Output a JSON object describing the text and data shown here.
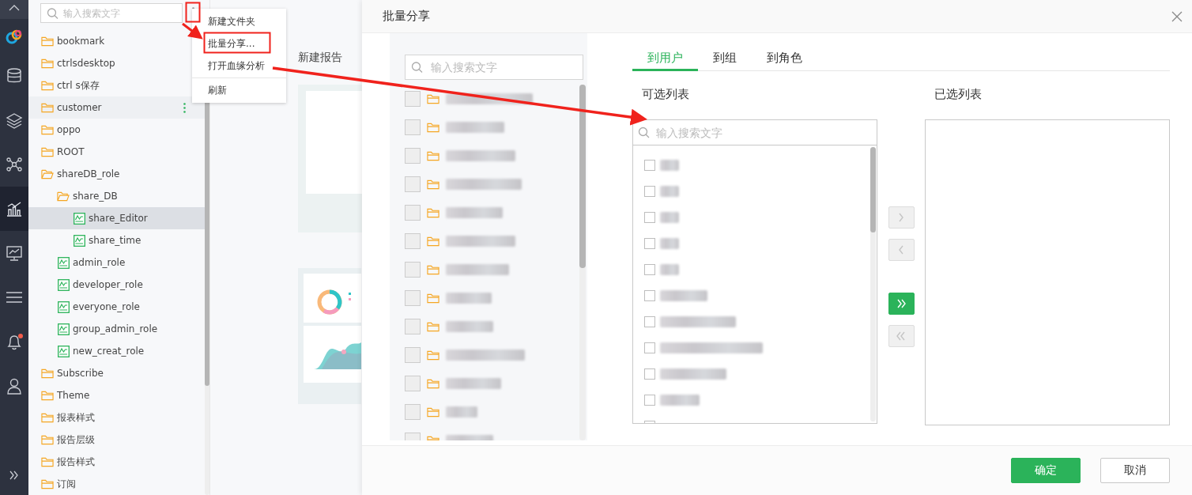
{
  "nav": [
    {
      "kind": "collapse-up",
      "selected": false,
      "alert": false
    },
    {
      "kind": "logo",
      "selected": false,
      "alert": false
    },
    {
      "kind": "database",
      "selected": false,
      "alert": false
    },
    {
      "kind": "layers",
      "selected": false,
      "alert": false
    },
    {
      "kind": "network",
      "selected": false,
      "alert": false
    },
    {
      "kind": "chart",
      "selected": true,
      "alert": false
    },
    {
      "kind": "monitor",
      "selected": false,
      "alert": false
    },
    {
      "kind": "menu",
      "selected": false,
      "alert": false
    },
    {
      "kind": "bell",
      "selected": false,
      "alert": true
    },
    {
      "kind": "user",
      "selected": false,
      "alert": false
    },
    {
      "kind": "expand",
      "selected": false,
      "alert": false
    }
  ],
  "tree": {
    "search": {
      "placeholder": "输入搜索文字"
    },
    "items": [
      {
        "label": "bookmark",
        "kind": "folder",
        "expanded": false,
        "selected": false,
        "hovered": false
      },
      {
        "label": "ctrlsdesktop",
        "kind": "folder",
        "expanded": false,
        "selected": false,
        "hovered": false
      },
      {
        "label": "ctrl s保存",
        "kind": "folder",
        "expanded": false,
        "selected": false,
        "hovered": false
      },
      {
        "label": "customer",
        "kind": "folder",
        "expanded": false,
        "selected": false,
        "hovered": true
      },
      {
        "label": "oppo",
        "kind": "folder",
        "expanded": false,
        "selected": false,
        "hovered": false
      },
      {
        "label": "ROOT",
        "kind": "folder",
        "expanded": false,
        "selected": false,
        "hovered": false
      },
      {
        "label": "shareDB_role",
        "kind": "folder",
        "expanded": true,
        "selected": false,
        "hovered": false,
        "children": [
          {
            "label": "share_DB",
            "kind": "folder",
            "expanded": true,
            "selected": false,
            "hovered": false,
            "children": [
              {
                "label": "share_Editor",
                "kind": "report",
                "selected": true,
                "hovered": false
              },
              {
                "label": "share_time",
                "kind": "report",
                "selected": false,
                "hovered": false
              }
            ]
          },
          {
            "label": "admin_role",
            "kind": "report",
            "selected": false,
            "hovered": false
          },
          {
            "label": "developer_role",
            "kind": "report",
            "selected": false,
            "hovered": false
          },
          {
            "label": "everyone_role",
            "kind": "report",
            "selected": false,
            "hovered": false
          },
          {
            "label": "group_admin_role",
            "kind": "report",
            "selected": false,
            "hovered": false
          },
          {
            "label": "new_creat_role",
            "kind": "report",
            "selected": false,
            "hovered": false
          }
        ]
      },
      {
        "label": "Subscribe",
        "kind": "folder",
        "expanded": false,
        "selected": false,
        "hovered": false
      },
      {
        "label": "Theme",
        "kind": "folder",
        "expanded": false,
        "selected": false,
        "hovered": false
      },
      {
        "label": "报表样式",
        "kind": "folder",
        "expanded": false,
        "selected": false,
        "hovered": false
      },
      {
        "label": "报告层级",
        "kind": "folder",
        "expanded": false,
        "selected": false,
        "hovered": false
      },
      {
        "label": "报告样式",
        "kind": "folder",
        "expanded": false,
        "selected": false,
        "hovered": false
      },
      {
        "label": "订阅",
        "kind": "folder",
        "expanded": false,
        "selected": false,
        "hovered": false
      }
    ]
  },
  "context_menu": {
    "items": [
      {
        "kind": "item",
        "label": "新建文件夹"
      },
      {
        "kind": "item",
        "label": "批量分享..."
      },
      {
        "kind": "item",
        "label": "打开血缘分析"
      },
      {
        "kind": "divider"
      },
      {
        "kind": "item",
        "label": "刷新"
      }
    ]
  },
  "main": {
    "heading": "新建报告"
  },
  "dialog": {
    "title": "批量分享",
    "source": {
      "search": {
        "placeholder": "输入搜索文字"
      },
      "rows": [
        {
          "checked": false
        },
        {
          "checked": false
        },
        {
          "checked": false
        },
        {
          "checked": false
        },
        {
          "checked": false
        },
        {
          "checked": false
        },
        {
          "checked": false
        },
        {
          "checked": false
        },
        {
          "checked": false
        },
        {
          "checked": false
        },
        {
          "checked": false
        },
        {
          "checked": false
        },
        {
          "checked": false
        }
      ]
    },
    "tabs": [
      {
        "label": "到用户",
        "selected": true
      },
      {
        "label": "到组",
        "selected": false
      },
      {
        "label": "到角色",
        "selected": false
      }
    ],
    "available": {
      "title": "可选列表",
      "search": {
        "placeholder": "输入搜索文字"
      },
      "rows": [
        {
          "checked": false
        },
        {
          "checked": false
        },
        {
          "checked": false
        },
        {
          "checked": false
        },
        {
          "checked": false
        },
        {
          "checked": false
        },
        {
          "checked": false
        },
        {
          "checked": false
        },
        {
          "checked": false
        },
        {
          "checked": false
        },
        {
          "checked": false
        }
      ]
    },
    "transfer_buttons": [
      {
        "kind": "move-right",
        "disabled": true
      },
      {
        "kind": "move-left",
        "disabled": true
      },
      {
        "kind": "move-all-right",
        "disabled": false
      },
      {
        "kind": "move-all-left",
        "disabled": true
      }
    ],
    "selected_list": {
      "title": "已选列表"
    },
    "buttons": [
      {
        "label": "确定",
        "kind": "primary"
      },
      {
        "label": "取消",
        "kind": "secondary"
      }
    ]
  }
}
